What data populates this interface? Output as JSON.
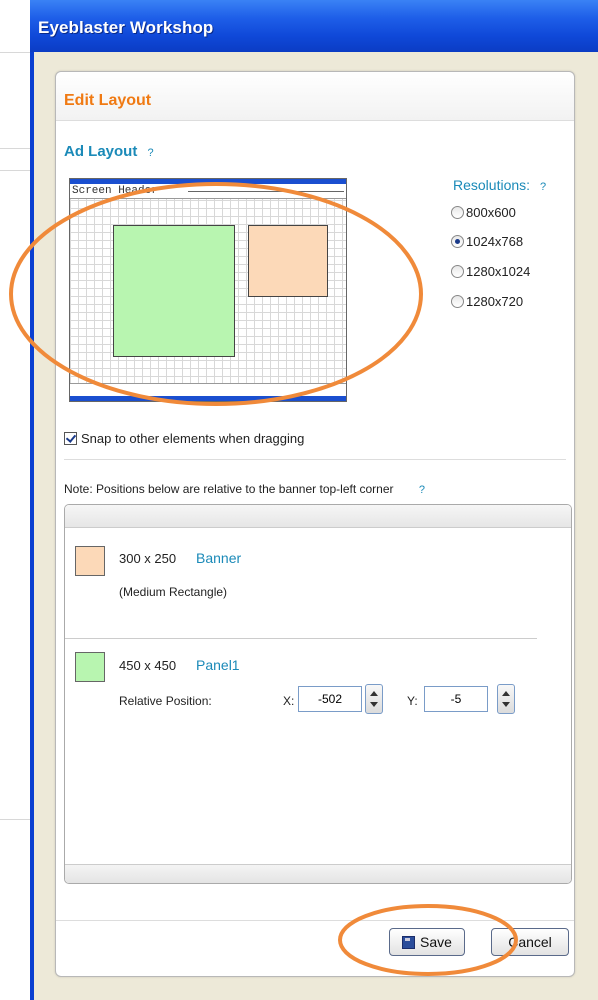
{
  "window": {
    "title": "Eyeblaster Workshop"
  },
  "panel": {
    "title": "Edit Layout"
  },
  "ad_layout": {
    "title": "Ad Layout",
    "help": "?",
    "preview_header_label": "Screen Header"
  },
  "resolutions": {
    "title": "Resolutions:",
    "help": "?",
    "options": [
      {
        "label": "800x600",
        "selected": false
      },
      {
        "label": "1024x768",
        "selected": true
      },
      {
        "label": "1280x1024",
        "selected": false
      },
      {
        "label": "1280x720",
        "selected": false
      }
    ]
  },
  "snap": {
    "label": "Snap to other elements when dragging",
    "checked": true
  },
  "note": {
    "text": "Note: Positions below are relative to the banner top-left corner",
    "help": "?"
  },
  "elements": [
    {
      "size": "300 x 250",
      "name": "Banner",
      "subtitle": "(Medium Rectangle)",
      "color": "#fcd9b8"
    },
    {
      "size": "450 x 450",
      "name": "Panel1",
      "color": "#b8f5b0",
      "relative_position_label": "Relative Position:",
      "x_label": "X:",
      "x_value": "-502",
      "y_label": "Y:",
      "y_value": "-5"
    }
  ],
  "buttons": {
    "save": "Save",
    "cancel": "Cancel"
  },
  "colors": {
    "accent_orange": "#f07a13",
    "link_blue": "#1b8ab8",
    "titlebar_blue": "#0f48d8"
  }
}
